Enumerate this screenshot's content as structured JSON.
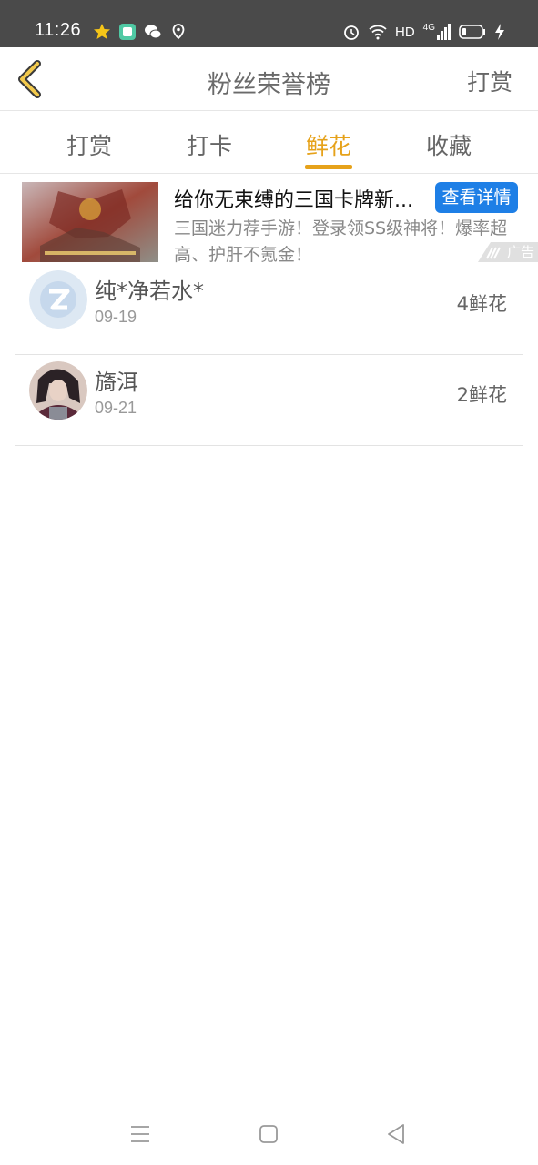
{
  "status_bar": {
    "time": "11:26",
    "hd_label": "HD",
    "network": "4G",
    "icons_left": [
      "star-icon",
      "app-icon",
      "wechat-icon",
      "location-icon"
    ],
    "icons_right": [
      "alarm-icon",
      "wifi-icon",
      "signal-icon",
      "battery-icon",
      "charging-icon"
    ]
  },
  "header": {
    "title": "粉丝荣誉榜",
    "action_label": "打赏",
    "back_icon": "chevron-left-icon"
  },
  "tabs": [
    {
      "label": "打赏",
      "active": false
    },
    {
      "label": "打卡",
      "active": false
    },
    {
      "label": "鲜花",
      "active": true
    },
    {
      "label": "收藏",
      "active": false
    }
  ],
  "ad": {
    "title": "给你无束缚的三国卡牌新...",
    "detail_button": "查看详情",
    "description": "三国迷力荐手游！登录领SS级神将！爆率超高、护肝不氪金！",
    "tag": "广告"
  },
  "list": [
    {
      "name": "纯*净若水*",
      "date": "09-19",
      "count": "4鲜花",
      "avatar": "default-avatar"
    },
    {
      "name": "旖洱",
      "date": "09-21",
      "count": "2鲜花",
      "avatar": "photo-avatar"
    }
  ],
  "nav_bar": {
    "buttons": [
      "menu-icon",
      "home-icon",
      "back-triangle-icon"
    ]
  },
  "colors": {
    "accent": "#e6a21a",
    "status_bar": "#4a4a4a",
    "ad_button": "#1e7fe6"
  }
}
